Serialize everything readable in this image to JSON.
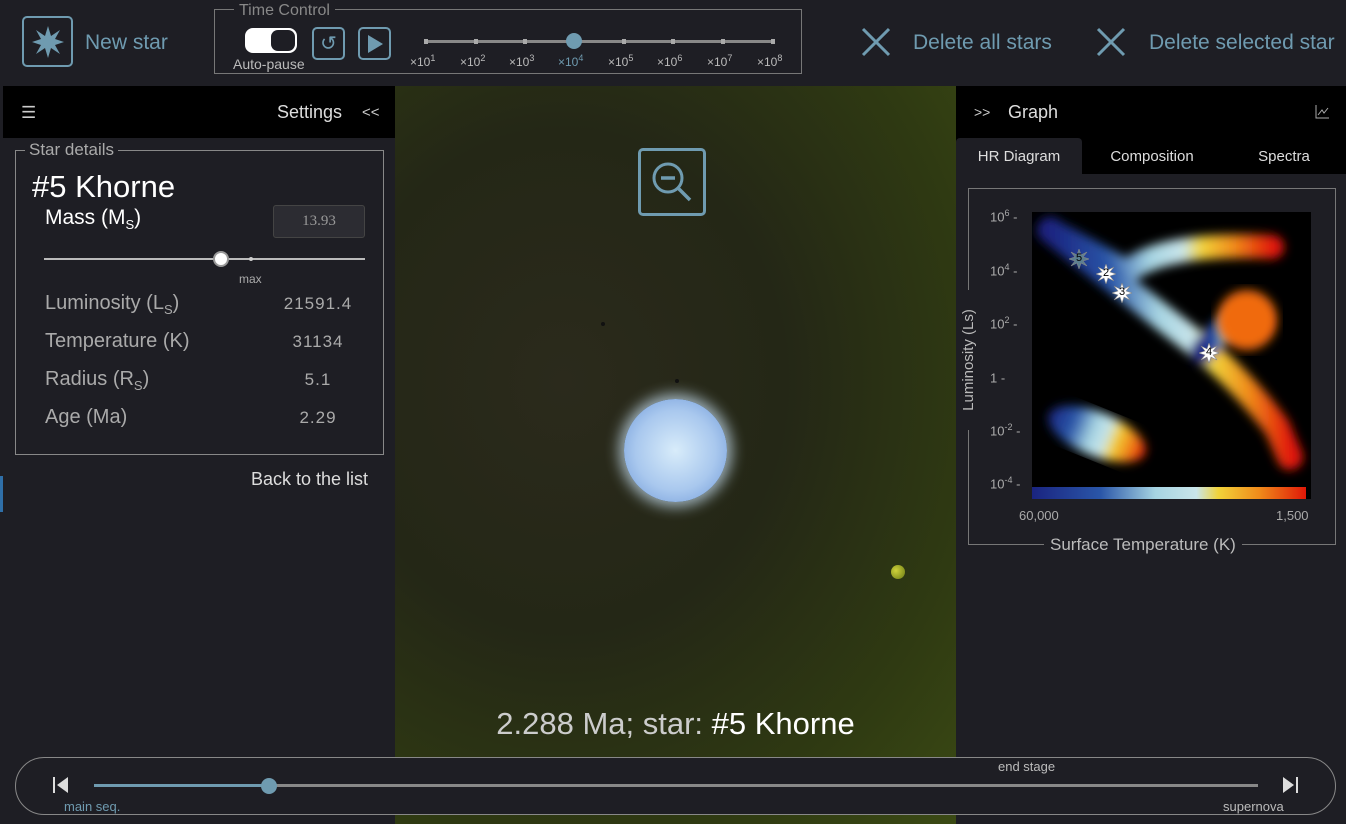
{
  "toolbar": {
    "new_star": "New star",
    "delete_all": "Delete all stars",
    "delete_selected": "Delete selected star"
  },
  "time_control": {
    "title": "Time Control",
    "auto_pause": "Auto-pause",
    "auto_pause_on": true,
    "speeds": [
      {
        "base": "×10",
        "exp": "1"
      },
      {
        "base": "×10",
        "exp": "2"
      },
      {
        "base": "×10",
        "exp": "3"
      },
      {
        "base": "×10",
        "exp": "4"
      },
      {
        "base": "×10",
        "exp": "5"
      },
      {
        "base": "×10",
        "exp": "6"
      },
      {
        "base": "×10",
        "exp": "7"
      },
      {
        "base": "×10",
        "exp": "8"
      }
    ],
    "selected_speed_index": 3
  },
  "settings": {
    "title": "Settings",
    "collapse": "<<",
    "group": "Star details",
    "star_name": "#5 Khorne",
    "mass_label": "Mass (M",
    "mass_sub": "S",
    "mass_value": "13.93",
    "mass_slider_fraction": 0.55,
    "max_label": "max",
    "rows": [
      {
        "label": "Luminosity (L",
        "sub": "S",
        "value": "21591.4"
      },
      {
        "label": "Temperature (K)",
        "sub": "",
        "value": "31134"
      },
      {
        "label": "Radius (R",
        "sub": "S",
        "value": "5.1"
      },
      {
        "label": "Age (Ma)",
        "sub": "",
        "value": "2.29"
      }
    ],
    "back": "Back to the list"
  },
  "viewport": {
    "status_prefix": "2.288 Ma; star: ",
    "status_star": "#5 Khorne"
  },
  "graph": {
    "expand": ">>",
    "title": "Graph",
    "tabs": [
      "HR Diagram",
      "Composition",
      "Spectra"
    ],
    "active_tab": 0,
    "ylabel": "Luminosity (Ls)",
    "xlabel": "Surface Temperature (K)",
    "x_left": "60,000",
    "x_right": "1,500",
    "yticks": [
      {
        "b": "10",
        "e": "6"
      },
      {
        "b": "10",
        "e": "4"
      },
      {
        "b": "10",
        "e": "2"
      },
      {
        "b": "1",
        "e": ""
      },
      {
        "b": "10",
        "e": "-2"
      },
      {
        "b": "10",
        "e": "-4"
      }
    ],
    "stars": [
      {
        "label": "5",
        "selected": true
      },
      {
        "label": "2"
      },
      {
        "label": "3"
      },
      {
        "label": "4"
      }
    ]
  },
  "timeline": {
    "start": "main seq.",
    "end": "supernova",
    "marker": "end stage",
    "progress": 0.15
  },
  "colors": {
    "accent": "#6f9bb0",
    "panel": "#1e1e24"
  }
}
